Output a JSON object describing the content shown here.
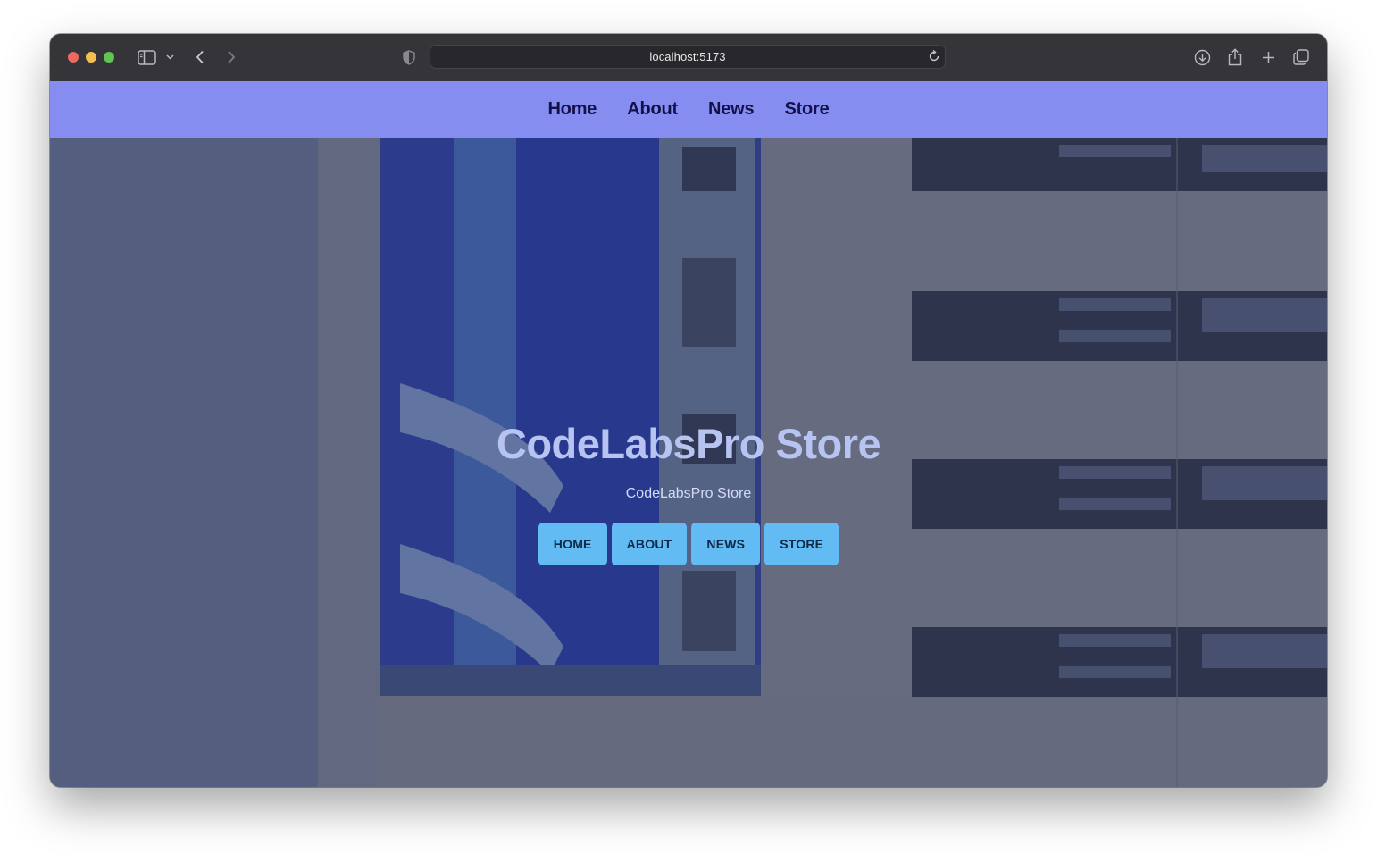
{
  "browser": {
    "url": "localhost:5173",
    "icons": {
      "sidebar": "sidebar-icon",
      "sidebar_menu": "chevron-down-icon",
      "back": "chevron-left-icon",
      "forward": "chevron-right-icon",
      "privacy": "shield-icon",
      "reload": "reload-icon",
      "downloads": "download-icon",
      "share": "share-icon",
      "new_tab": "plus-icon",
      "tabs": "tabs-overview-icon"
    }
  },
  "navbar": {
    "links": [
      {
        "label": "Home"
      },
      {
        "label": "About"
      },
      {
        "label": "News"
      },
      {
        "label": "Store"
      }
    ],
    "background": "#858ef0",
    "text_color": "#14114a"
  },
  "hero": {
    "title": "CodeLabsPro Store",
    "subtitle": "CodeLabsPro Store",
    "buttons": [
      {
        "label": "HOME"
      },
      {
        "label": "ABOUT"
      },
      {
        "label": "NEWS"
      },
      {
        "label": "STORE"
      }
    ],
    "button_color": "#63bbf4",
    "title_color": "#b7c4f2"
  }
}
